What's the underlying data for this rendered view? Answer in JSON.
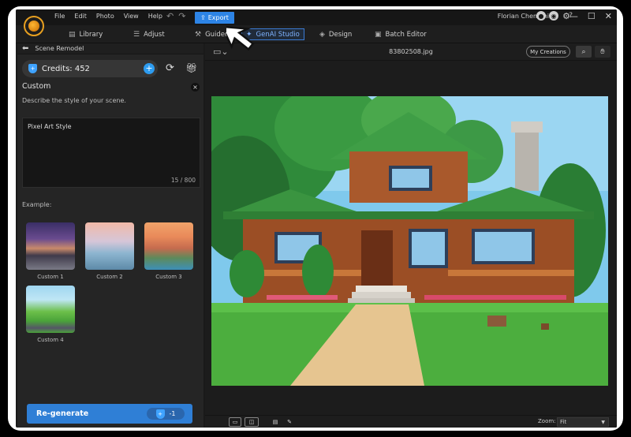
{
  "menu": [
    "File",
    "Edit",
    "Photo",
    "View",
    "Help"
  ],
  "toolbar": {
    "export_label": "Export"
  },
  "user": {
    "name": "Florian Chemani"
  },
  "modes": [
    {
      "label": "Library",
      "icon": "library-icon"
    },
    {
      "label": "Adjust",
      "icon": "sliders-icon"
    },
    {
      "label": "Guided",
      "icon": "wand-icon"
    },
    {
      "label": "GenAI Studio",
      "icon": "sparkle-icon"
    },
    {
      "label": "Design",
      "icon": "design-icon"
    },
    {
      "label": "Batch Editor",
      "icon": "batch-icon"
    }
  ],
  "panel": {
    "title": "Scene Remodel",
    "credits_label": "Credits: 452",
    "section_title": "Custom",
    "description": "Describe the style of your scene.",
    "prompt_text": "Pixel Art Style",
    "char_count": "15 / 800",
    "example_label": "Example:",
    "examples": [
      "Custom 1",
      "Custom 2",
      "Custom 3",
      "Custom 4"
    ],
    "regenerate_label": "Re-generate",
    "regenerate_cost": "-1"
  },
  "viewer": {
    "filename": "83802508.jpg",
    "my_creations": "My Creations",
    "zoom_label": "Zoom:",
    "zoom_value": "Fit"
  },
  "colors": {
    "accent": "#2f7fd6",
    "export": "#2d84e6",
    "logo": "#e8a020"
  }
}
